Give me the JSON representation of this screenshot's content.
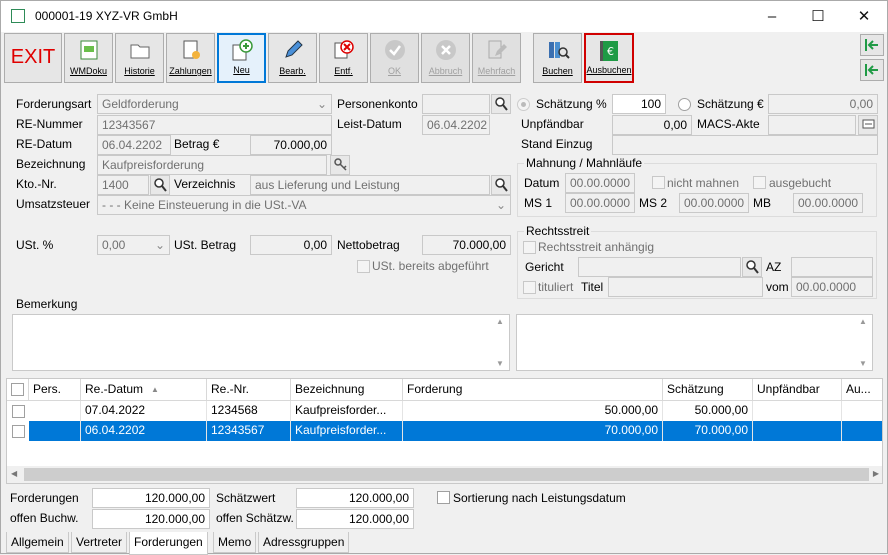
{
  "window": {
    "title": "000001-19 XYZ-VR GmbH",
    "minimize": "–",
    "maximize": "☐",
    "close": "✕"
  },
  "toolbar": {
    "exit": "EXIT",
    "wmdoku": "WMDoku",
    "historie": "Historie",
    "zahlungen": "Zahlungen",
    "neu": "Neu",
    "bearb": "Bearb.",
    "entf": "Entf.",
    "ok": "OK",
    "abbruch": "Abbruch",
    "mehrfach": "Mehrfach",
    "buchen": "Buchen",
    "ausbuchen": "Ausbuchen"
  },
  "form": {
    "forderungsart_label": "Forderungsart",
    "forderungsart": "Geldforderung",
    "personenkonto_label": "Personenkonto",
    "personenkonto": "",
    "schaetzung_pct_label": "Schätzung %",
    "schaetzung_pct": "100",
    "schaetzung_eur_label": "Schätzung €",
    "schaetzung_eur": "0,00",
    "re_nummer_label": "RE-Nummer",
    "re_nummer": "12343567",
    "leist_datum_label": "Leist-Datum",
    "leist_datum": "06.04.2202",
    "unpfaendbar_label": "Unpfändbar",
    "unpfaendbar": "0,00",
    "macs_akte_label": "MACS-Akte",
    "macs_akte": "",
    "re_datum_label": "RE-Datum",
    "re_datum": "06.04.2202",
    "betrag_label": "Betrag €",
    "betrag": "70.000,00",
    "stand_einzug_label": "Stand Einzug",
    "stand_einzug": "",
    "bezeichnung_label": "Bezeichnung",
    "bezeichnung": "Kaufpreisforderung",
    "kto_nr_label": "Kto.-Nr.",
    "kto_nr": "1400",
    "verzeichnis_label": "Verzeichnis",
    "verzeichnis": "aus Lieferung und Leistung",
    "umsatzsteuer_label": "Umsatzsteuer",
    "umsatzsteuer": "- - - Keine Einsteuerung in die USt.-VA",
    "ust_pct_label": "USt. %",
    "ust_pct": "0,00",
    "ust_betrag_label": "USt. Betrag",
    "ust_betrag": "0,00",
    "nettobetrag_label": "Nettobetrag",
    "nettobetrag": "70.000,00",
    "ust_abgefuehrt_label": "USt. bereits abgeführt",
    "bemerkung_label": "Bemerkung"
  },
  "mahnung": {
    "title": "Mahnung / Mahnläufe",
    "datum_label": "Datum",
    "datum": "00.00.0000",
    "nicht_mahnen_label": "nicht mahnen",
    "ausgebucht_label": "ausgebucht",
    "ms1_label": "MS 1",
    "ms1": "00.00.0000",
    "ms2_label": "MS 2",
    "ms2": "00.00.0000",
    "mb_label": "MB",
    "mb": "00.00.0000"
  },
  "rechtsstreit": {
    "title": "Rechtsstreit",
    "anhaengig_label": "Rechtsstreit anhängig",
    "gericht_label": "Gericht",
    "gericht": "",
    "az_label": "AZ",
    "az": "",
    "tituliert_label": "tituliert",
    "titel_label": "Titel",
    "titel": "",
    "vom_label": "vom",
    "vom": "00.00.0000"
  },
  "table": {
    "headers": [
      "Pers.",
      "Re.-Datum",
      "Re.-Nr.",
      "Bezeichnung",
      "Forderung",
      "Schätzung",
      "Unpfändbar",
      "Au..."
    ],
    "rows": [
      {
        "pers": "",
        "datum": "07.04.2022",
        "nr": "1234568",
        "bez": "Kaufpreisforder...",
        "ford": "50.000,00",
        "sch": "50.000,00",
        "unp": ""
      },
      {
        "pers": "",
        "datum": "06.04.2202",
        "nr": "12343567",
        "bez": "Kaufpreisforder...",
        "ford": "70.000,00",
        "sch": "70.000,00",
        "unp": ""
      }
    ]
  },
  "totals": {
    "forderungen_label": "Forderungen",
    "forderungen": "120.000,00",
    "offen_buchw_label": "offen Buchw.",
    "offen_buchw": "120.000,00",
    "schaetzwert_label": "Schätzwert",
    "schaetzwert": "120.000,00",
    "offen_schaetzw_label": "offen Schätzw.",
    "offen_schaetzw": "120.000,00",
    "sortierung_label": "Sortierung nach Leistungsdatum"
  },
  "tabs": [
    "Allgemein",
    "Vertreter",
    "Forderungen",
    "Memo",
    "Adressgruppen"
  ],
  "colors": {
    "accent": "#0078d7",
    "exit": "#e00000"
  }
}
